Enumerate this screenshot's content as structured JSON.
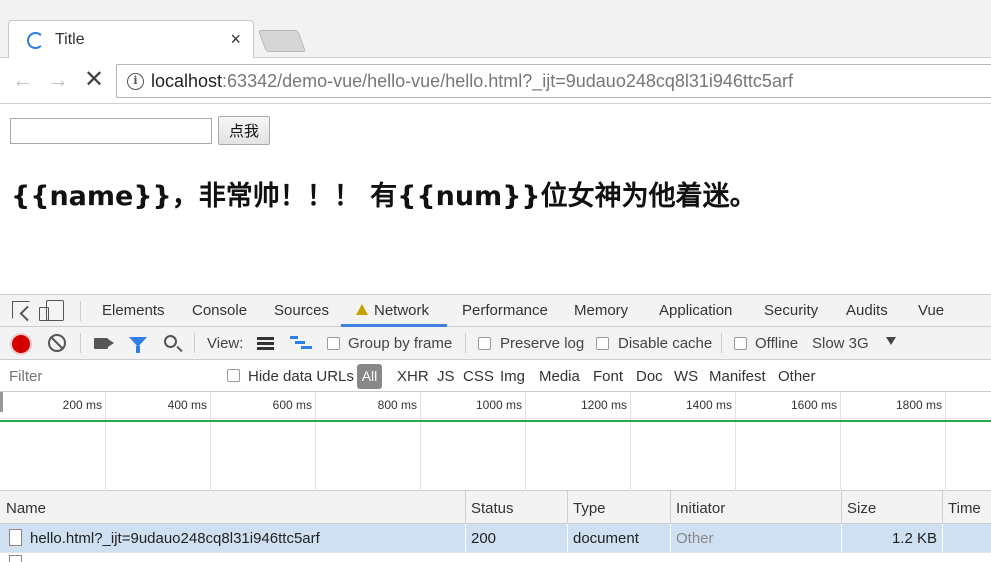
{
  "browser": {
    "tab": {
      "title": "Title",
      "close": "×"
    },
    "nav": {
      "back": "←",
      "forward": "→",
      "stop": "✕"
    },
    "url": {
      "host": "localhost",
      "rest": ":63342/demo-vue/hello-vue/hello.html?_ijt=9udauo248cq8l31i946ttc5arf",
      "info": "i"
    }
  },
  "page": {
    "input_value": "",
    "button_label": "点我",
    "headline": "{{name}}，非常帅！！！ 有{{num}}位女神为他着迷。"
  },
  "devtools": {
    "tabs": [
      "Elements",
      "Console",
      "Sources",
      "Network",
      "Performance",
      "Memory",
      "Application",
      "Security",
      "Audits",
      "Vue"
    ],
    "active_tab": "Network",
    "toolbar": {
      "view_label": "View:",
      "group_by_frame": "Group by frame",
      "preserve_log": "Preserve log",
      "disable_cache": "Disable cache",
      "offline": "Offline",
      "throttle": "Slow 3G"
    },
    "filter_bar": {
      "placeholder": "Filter",
      "hide_data_urls": "Hide data URLs",
      "types": [
        "All",
        "XHR",
        "JS",
        "CSS",
        "Img",
        "Media",
        "Font",
        "Doc",
        "WS",
        "Manifest",
        "Other"
      ],
      "active_type": "All"
    },
    "overview": {
      "ticks": [
        "200 ms",
        "400 ms",
        "600 ms",
        "800 ms",
        "1000 ms",
        "1200 ms",
        "1400 ms",
        "1600 ms",
        "1800 ms"
      ]
    },
    "table": {
      "columns": [
        "Name",
        "Status",
        "Type",
        "Initiator",
        "Size",
        "Time"
      ],
      "rows": [
        {
          "name": "hello.html?_ijt=9udauo248cq8l31i946ttc5arf",
          "status": "200",
          "type": "document",
          "initiator": "Other",
          "size": "1.2 KB",
          "time": ""
        }
      ]
    },
    "colors": {
      "accent": "#3f7fe0",
      "record": "#d50000",
      "timeline": "#26a94b",
      "selected_row": "#cfe0f2"
    }
  }
}
